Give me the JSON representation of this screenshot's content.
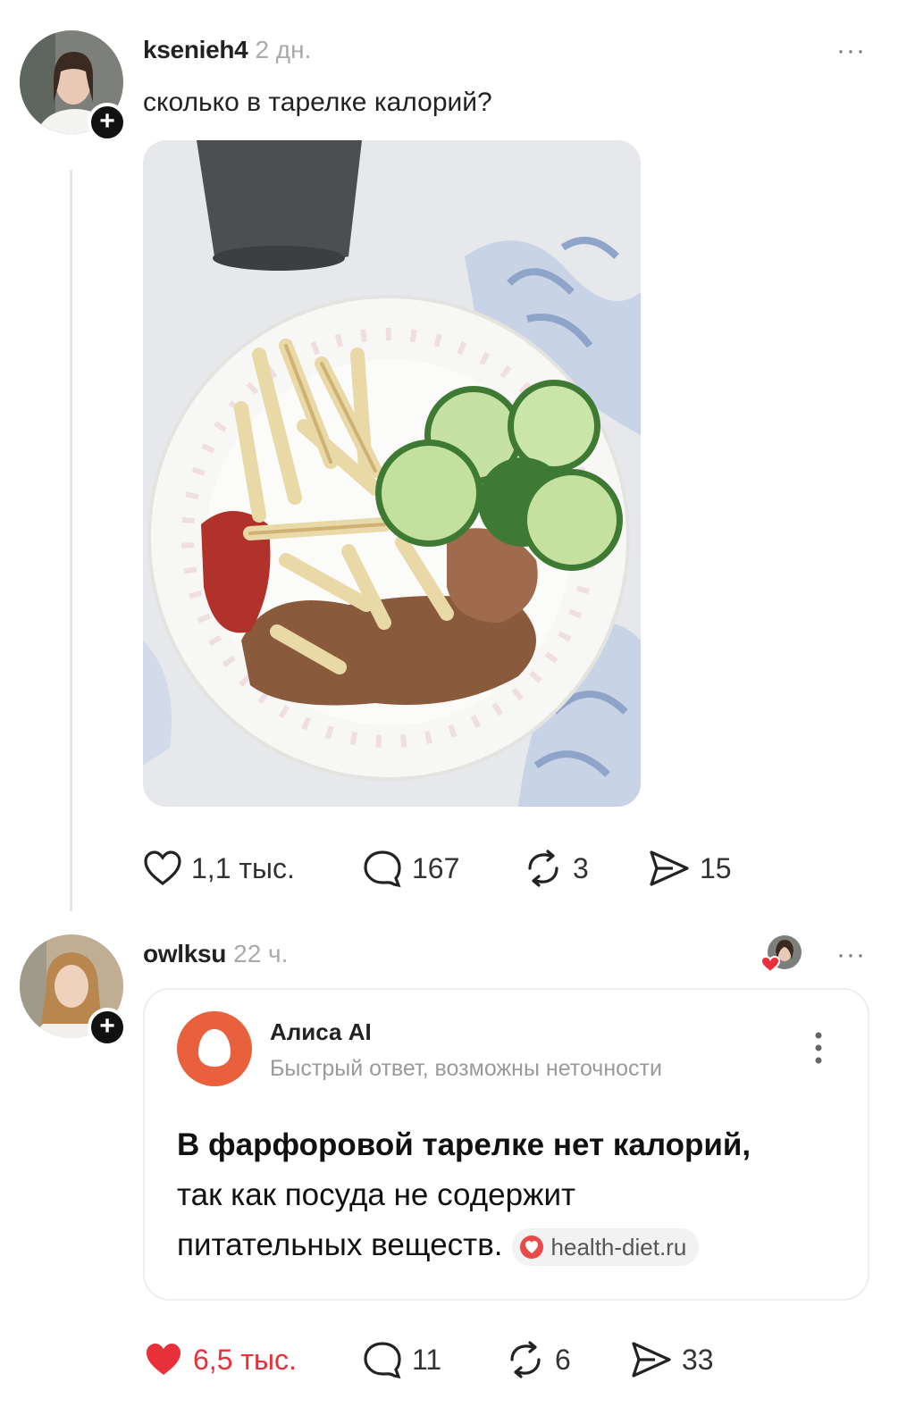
{
  "post1": {
    "username": "ksenieh4",
    "time": "2 дн.",
    "text": "сколько в тарелке калорий?",
    "more": "···",
    "likes": "1,1 тыс.",
    "comments": "167",
    "reposts": "3",
    "shares": "15"
  },
  "post2": {
    "username": "owlksu",
    "time": "22 ч.",
    "more": "···",
    "likes": "6,5 тыс.",
    "comments": "11",
    "reposts": "6",
    "shares": "33",
    "card": {
      "title": "Алиса AI",
      "subtitle": "Быстрый ответ, возможны неточности",
      "answer_bold": "В фарфоровой тарелке нет калорий,",
      "answer_rest_line1": "так как посуда не содержит",
      "answer_rest_line2": "питательных веществ.",
      "source": "health-diet.ru"
    }
  },
  "colors": {
    "like_active": "#e8303a",
    "alice_brand": "#e8603c",
    "muted_text": "#aaaaaa"
  }
}
